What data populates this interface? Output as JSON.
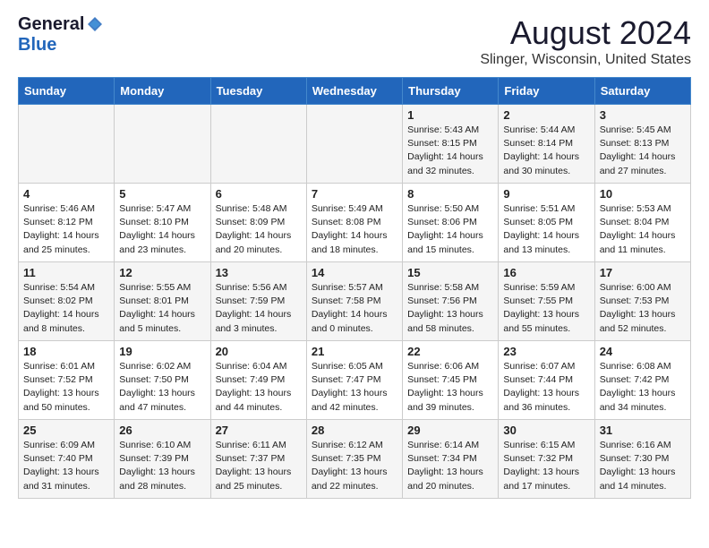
{
  "logo": {
    "general": "General",
    "blue": "Blue"
  },
  "title": "August 2024",
  "location": "Slinger, Wisconsin, United States",
  "days_of_week": [
    "Sunday",
    "Monday",
    "Tuesday",
    "Wednesday",
    "Thursday",
    "Friday",
    "Saturday"
  ],
  "weeks": [
    [
      {
        "day": "",
        "info": ""
      },
      {
        "day": "",
        "info": ""
      },
      {
        "day": "",
        "info": ""
      },
      {
        "day": "",
        "info": ""
      },
      {
        "day": "1",
        "info": "Sunrise: 5:43 AM\nSunset: 8:15 PM\nDaylight: 14 hours\nand 32 minutes."
      },
      {
        "day": "2",
        "info": "Sunrise: 5:44 AM\nSunset: 8:14 PM\nDaylight: 14 hours\nand 30 minutes."
      },
      {
        "day": "3",
        "info": "Sunrise: 5:45 AM\nSunset: 8:13 PM\nDaylight: 14 hours\nand 27 minutes."
      }
    ],
    [
      {
        "day": "4",
        "info": "Sunrise: 5:46 AM\nSunset: 8:12 PM\nDaylight: 14 hours\nand 25 minutes."
      },
      {
        "day": "5",
        "info": "Sunrise: 5:47 AM\nSunset: 8:10 PM\nDaylight: 14 hours\nand 23 minutes."
      },
      {
        "day": "6",
        "info": "Sunrise: 5:48 AM\nSunset: 8:09 PM\nDaylight: 14 hours\nand 20 minutes."
      },
      {
        "day": "7",
        "info": "Sunrise: 5:49 AM\nSunset: 8:08 PM\nDaylight: 14 hours\nand 18 minutes."
      },
      {
        "day": "8",
        "info": "Sunrise: 5:50 AM\nSunset: 8:06 PM\nDaylight: 14 hours\nand 15 minutes."
      },
      {
        "day": "9",
        "info": "Sunrise: 5:51 AM\nSunset: 8:05 PM\nDaylight: 14 hours\nand 13 minutes."
      },
      {
        "day": "10",
        "info": "Sunrise: 5:53 AM\nSunset: 8:04 PM\nDaylight: 14 hours\nand 11 minutes."
      }
    ],
    [
      {
        "day": "11",
        "info": "Sunrise: 5:54 AM\nSunset: 8:02 PM\nDaylight: 14 hours\nand 8 minutes."
      },
      {
        "day": "12",
        "info": "Sunrise: 5:55 AM\nSunset: 8:01 PM\nDaylight: 14 hours\nand 5 minutes."
      },
      {
        "day": "13",
        "info": "Sunrise: 5:56 AM\nSunset: 7:59 PM\nDaylight: 14 hours\nand 3 minutes."
      },
      {
        "day": "14",
        "info": "Sunrise: 5:57 AM\nSunset: 7:58 PM\nDaylight: 14 hours\nand 0 minutes."
      },
      {
        "day": "15",
        "info": "Sunrise: 5:58 AM\nSunset: 7:56 PM\nDaylight: 13 hours\nand 58 minutes."
      },
      {
        "day": "16",
        "info": "Sunrise: 5:59 AM\nSunset: 7:55 PM\nDaylight: 13 hours\nand 55 minutes."
      },
      {
        "day": "17",
        "info": "Sunrise: 6:00 AM\nSunset: 7:53 PM\nDaylight: 13 hours\nand 52 minutes."
      }
    ],
    [
      {
        "day": "18",
        "info": "Sunrise: 6:01 AM\nSunset: 7:52 PM\nDaylight: 13 hours\nand 50 minutes."
      },
      {
        "day": "19",
        "info": "Sunrise: 6:02 AM\nSunset: 7:50 PM\nDaylight: 13 hours\nand 47 minutes."
      },
      {
        "day": "20",
        "info": "Sunrise: 6:04 AM\nSunset: 7:49 PM\nDaylight: 13 hours\nand 44 minutes."
      },
      {
        "day": "21",
        "info": "Sunrise: 6:05 AM\nSunset: 7:47 PM\nDaylight: 13 hours\nand 42 minutes."
      },
      {
        "day": "22",
        "info": "Sunrise: 6:06 AM\nSunset: 7:45 PM\nDaylight: 13 hours\nand 39 minutes."
      },
      {
        "day": "23",
        "info": "Sunrise: 6:07 AM\nSunset: 7:44 PM\nDaylight: 13 hours\nand 36 minutes."
      },
      {
        "day": "24",
        "info": "Sunrise: 6:08 AM\nSunset: 7:42 PM\nDaylight: 13 hours\nand 34 minutes."
      }
    ],
    [
      {
        "day": "25",
        "info": "Sunrise: 6:09 AM\nSunset: 7:40 PM\nDaylight: 13 hours\nand 31 minutes."
      },
      {
        "day": "26",
        "info": "Sunrise: 6:10 AM\nSunset: 7:39 PM\nDaylight: 13 hours\nand 28 minutes."
      },
      {
        "day": "27",
        "info": "Sunrise: 6:11 AM\nSunset: 7:37 PM\nDaylight: 13 hours\nand 25 minutes."
      },
      {
        "day": "28",
        "info": "Sunrise: 6:12 AM\nSunset: 7:35 PM\nDaylight: 13 hours\nand 22 minutes."
      },
      {
        "day": "29",
        "info": "Sunrise: 6:14 AM\nSunset: 7:34 PM\nDaylight: 13 hours\nand 20 minutes."
      },
      {
        "day": "30",
        "info": "Sunrise: 6:15 AM\nSunset: 7:32 PM\nDaylight: 13 hours\nand 17 minutes."
      },
      {
        "day": "31",
        "info": "Sunrise: 6:16 AM\nSunset: 7:30 PM\nDaylight: 13 hours\nand 14 minutes."
      }
    ]
  ]
}
